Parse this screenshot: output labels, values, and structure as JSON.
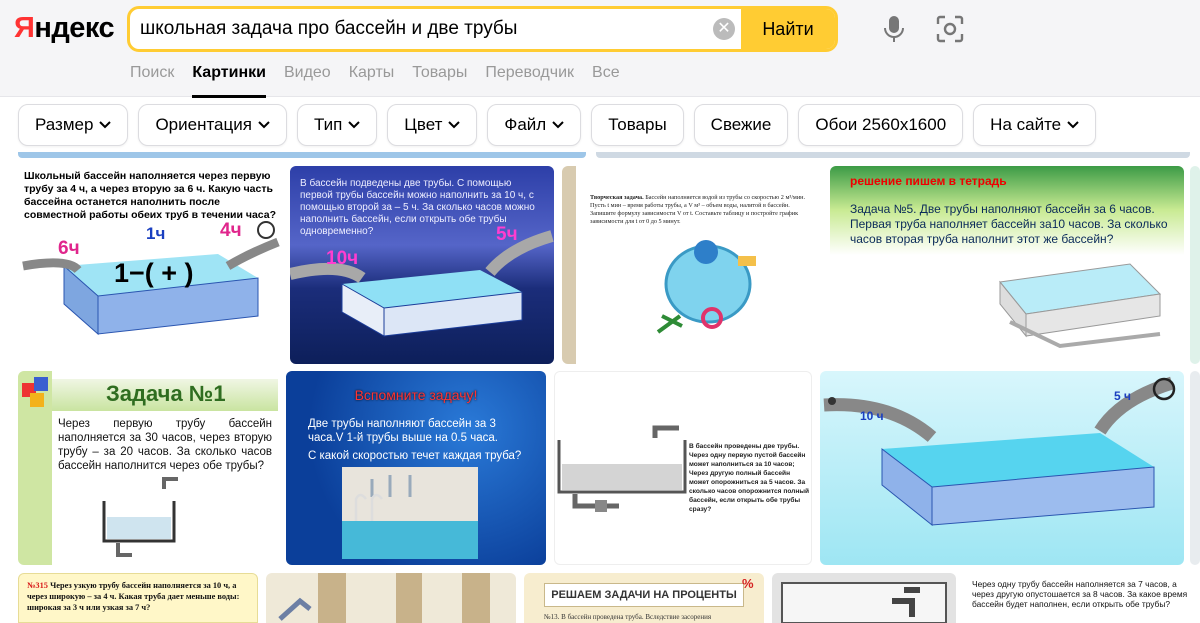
{
  "header": {
    "logo": "Яндекс",
    "search_query": "школьная задача про бассейн и две трубы",
    "find_label": "Найти"
  },
  "tabs": [
    {
      "label": "Поиск",
      "active": false
    },
    {
      "label": "Картинки",
      "active": true
    },
    {
      "label": "Видео",
      "active": false
    },
    {
      "label": "Карты",
      "active": false
    },
    {
      "label": "Товары",
      "active": false
    },
    {
      "label": "Переводчик",
      "active": false
    },
    {
      "label": "Все",
      "active": false
    }
  ],
  "filters": [
    {
      "label": "Размер",
      "dropdown": true
    },
    {
      "label": "Ориентация",
      "dropdown": true
    },
    {
      "label": "Тип",
      "dropdown": true
    },
    {
      "label": "Цвет",
      "dropdown": true
    },
    {
      "label": "Файл",
      "dropdown": true
    },
    {
      "label": "Товары",
      "dropdown": false
    },
    {
      "label": "Свежие",
      "dropdown": false
    },
    {
      "label": "Обои 2560x1600",
      "dropdown": false
    },
    {
      "label": "На сайте",
      "dropdown": true
    }
  ],
  "results": {
    "r1": {
      "text": "Школьный бассейн наполняется через первую трубу за 4 ч, а через вторую за 6 ч. Какую часть бассейна останется наполнить после совместной работы обеих труб в течении часа?",
      "l1": "6ч",
      "l2": "1ч",
      "l3": "4ч",
      "formula": "1−( + )"
    },
    "r2": {
      "text": "В бассейн подведены две трубы. С помощью первой трубы бассейн можно наполнить за 10 ч, с помощью второй за – 5 ч. За сколько часов можно наполнить бассейн, если открыть обе трубы одновременно?",
      "l1": "10ч",
      "l2": "5ч"
    },
    "r3": {
      "title": "Творческая задача.",
      "text": "Бассейн наполняется водой из трубы со скоростью 2 м³/мин. Пусть t мин – время работы трубы, а V м³ – объем воды, налитой в бассейн. Запишите формулу зависимости V от t. Составьте таблицу и постройте график зависимости для t от 0 до 5 минут."
    },
    "r4": {
      "header": "решение пишем в тетрадь",
      "text": "Задача №5. Две трубы наполняют бассейн за 6 часов. Первая труба наполняет бассейн за10 часов. За сколько часов вторая труба наполнит этот же бассейн?"
    },
    "r5": {
      "title": "Задача №1",
      "text": "Через первую трубу бассейн наполняется за 30 часов, через вторую трубу – за 20 часов. За сколько часов бассейн наполнится через обе трубы?"
    },
    "r6": {
      "title": "Вспомните задачу!",
      "text1": "Две трубы наполняют бассейн за 3 часа.V 1-й трубы выше на 0.5 часа.",
      "text2": "С какой скоростью течет каждая труба?"
    },
    "r7": {
      "text": "В бассейн проведены две трубы. Через одну первую пустой бассейн может наполниться за 10 часов; Через другую полный бассейн может опорожниться за 5 часов. За сколько часов опорожнится полный бассейн, если открыть обе трубы сразу?"
    },
    "r8": {
      "l1": "10 ч",
      "l2": "5 ч"
    },
    "r9": {
      "num": "№315",
      "text": "Через узкую трубу бассейн наполняется за 10 ч, а через широкую – за 4 ч. Какая труба дает меньше воды: широкая за 3 ч или узкая за 7 ч?"
    },
    "r11": {
      "title": "РЕШАЕМ ЗАДАЧИ НА ПРОЦЕНТЫ",
      "badge": "%",
      "text": "№13. В бассейн проведена труба. Вследствие засорения"
    },
    "r13": {
      "text": "Через одну трубу бассейн наполняется за 7 часов, а через другую опустошается за 8 часов. За какое время бассейн будет наполнен, если открыть обе трубы?"
    }
  },
  "colors": {
    "brand_yellow": "#ffcc33",
    "logo_red": "#ff3333"
  }
}
